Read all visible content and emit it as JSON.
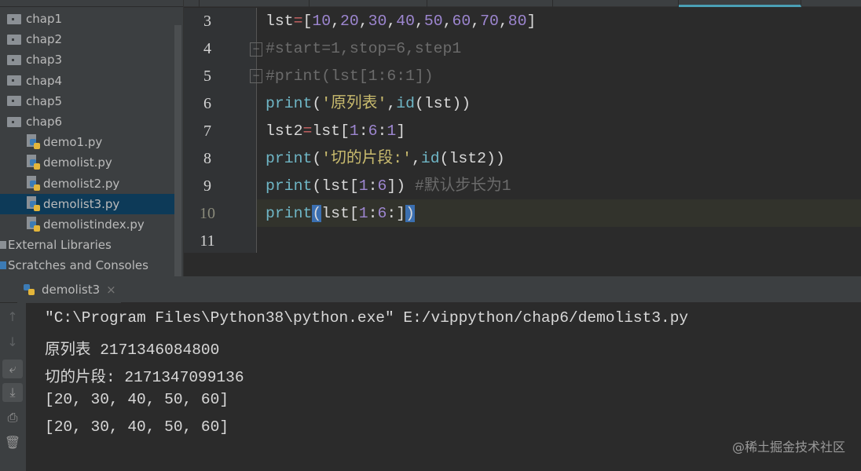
{
  "sidebar": {
    "items": [
      {
        "label": "chap1",
        "type": "folder"
      },
      {
        "label": "chap2",
        "type": "folder"
      },
      {
        "label": "chap3",
        "type": "folder"
      },
      {
        "label": "chap4",
        "type": "folder"
      },
      {
        "label": "chap5",
        "type": "folder"
      },
      {
        "label": "chap6",
        "type": "folder"
      },
      {
        "label": "demo1.py",
        "type": "file"
      },
      {
        "label": "demolist.py",
        "type": "file"
      },
      {
        "label": "demolist2.py",
        "type": "file"
      },
      {
        "label": "demolist3.py",
        "type": "file",
        "selected": true
      },
      {
        "label": "demolistindex.py",
        "type": "file"
      },
      {
        "label": "External Libraries",
        "type": "lib"
      },
      {
        "label": "Scratches and Consoles",
        "type": "scratch"
      }
    ]
  },
  "editor": {
    "line_numbers": [
      "3",
      "4",
      "5",
      "6",
      "7",
      "8",
      "9",
      "10",
      "11"
    ],
    "current_line": "10"
  },
  "run": {
    "tab_label": "demolist3",
    "close": "×"
  },
  "console": {
    "lines": [
      "\"C:\\Program Files\\Python38\\python.exe\" E:/vippython/chap6/demolist3.py",
      "原列表 2171346084800",
      "切的片段: 2171347099136",
      "[20, 30, 40, 50, 60]",
      "[20, 30, 40, 50, 60]"
    ]
  },
  "watermark": "@稀土掘金技术社区"
}
